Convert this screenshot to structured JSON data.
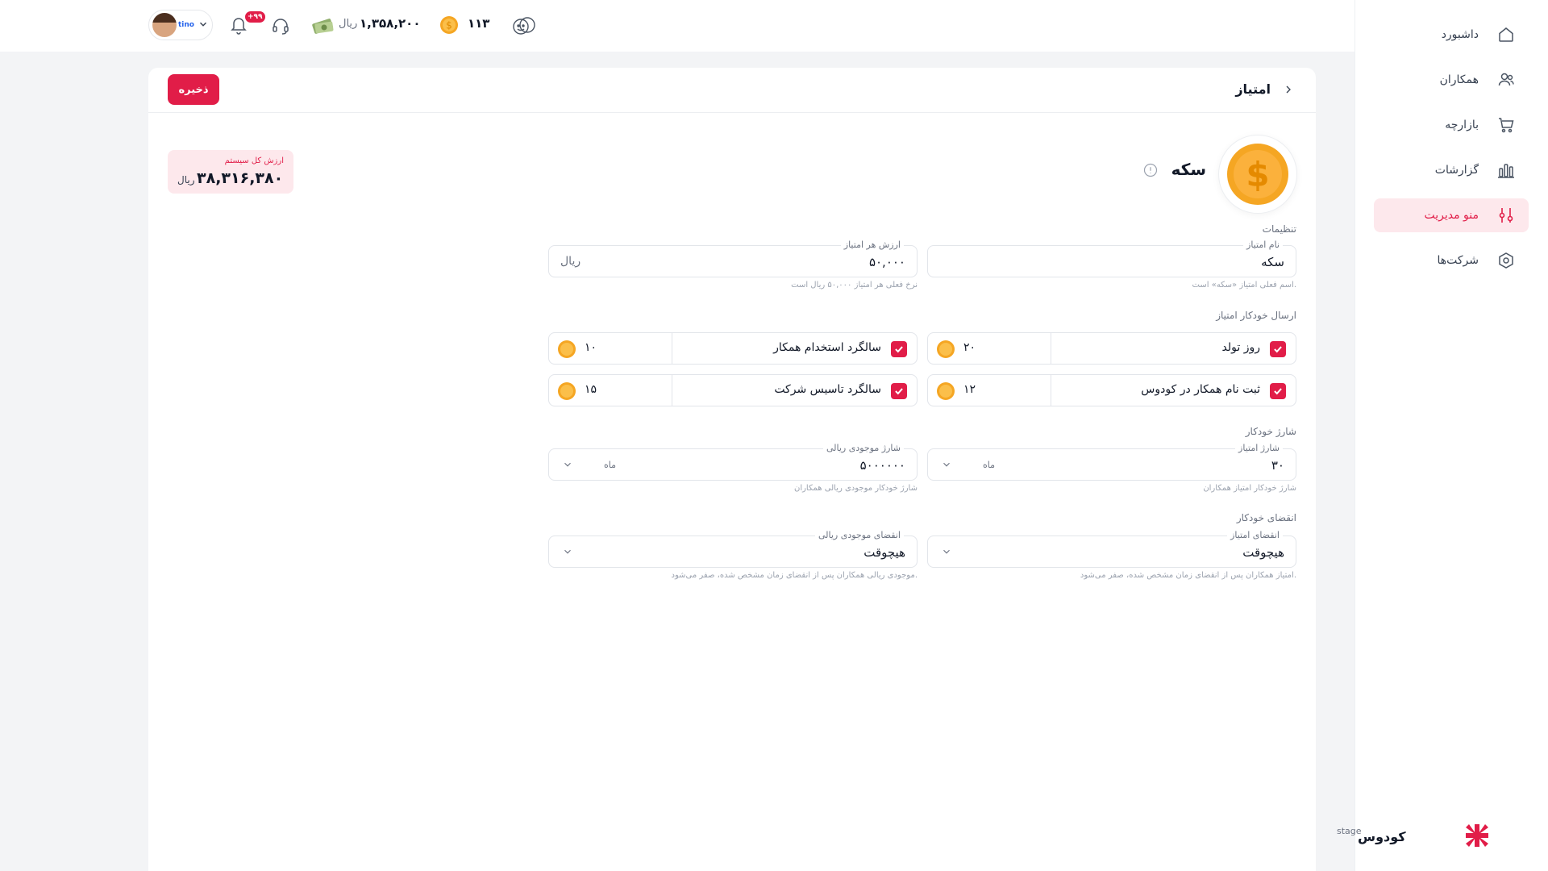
{
  "sidebar": {
    "items": [
      {
        "label": "داشبورد",
        "icon": "home-icon"
      },
      {
        "label": "همکاران",
        "icon": "users-icon"
      },
      {
        "label": "بازارچه",
        "icon": "cart-icon"
      },
      {
        "label": "گزارشات",
        "icon": "chart-bars-icon"
      },
      {
        "label": "منو مدیریت",
        "icon": "sliders-icon",
        "active": true
      },
      {
        "label": "شرکت‌ها",
        "icon": "company-icon"
      }
    ],
    "logo": {
      "stage": "stage",
      "brand": "کودوس"
    }
  },
  "topbar": {
    "profile_tag": "tino",
    "notification_badge": "+۹۹",
    "money_value": "۱,۳۵۸,۲۰۰",
    "money_unit": "ریال",
    "coin_count": "۱۱۳"
  },
  "page": {
    "title": "امتیاز",
    "save_label": "ذخیره",
    "system_value": {
      "label": "ارزش کل سیستم",
      "value": "۳۸,۳۱۶,۳۸۰",
      "unit": "ریال"
    },
    "coin_title": "سکه"
  },
  "settings": {
    "section_label": "تنظیمات",
    "name_field": {
      "label": "نام امتیاز",
      "value": "سکه",
      "hint": "اسم فعلی امتیاز «سکه» است."
    },
    "value_field": {
      "label": "ارزش هر امتیاز",
      "value": "۵۰,۰۰۰",
      "suffix": "ریال",
      "hint": "نرخ فعلی هر امتیاز ۵۰,۰۰۰ ریال است"
    }
  },
  "auto_send": {
    "section_label": "ارسال خودکار امتیاز",
    "items": [
      {
        "label": "روز تولد",
        "value": "۲۰",
        "checked": true
      },
      {
        "label": "سالگرد استخدام همکار",
        "value": "۱۰",
        "checked": true
      },
      {
        "label": "ثبت نام همکار در کودوس",
        "value": "۱۲",
        "checked": true
      },
      {
        "label": "سالگرد تاسیس شرکت",
        "value": "۱۵",
        "checked": true
      }
    ]
  },
  "auto_charge": {
    "section_label": "شارژ خودکار",
    "point_charge": {
      "label": "شارژ امتیاز",
      "value": "۳۰",
      "period": "ماه",
      "hint": "شارژ خودکار امتیاز همکاران"
    },
    "rial_charge": {
      "label": "شارژ موجودی ریالی",
      "value": "۵۰۰۰۰۰۰",
      "period": "ماه",
      "hint": "شارژ خودکار موجودی ریالی همکاران"
    }
  },
  "auto_expire": {
    "section_label": "انقضای خودکار",
    "point_expire": {
      "label": "انقضای امتیاز",
      "value": "هیچوقت",
      "hint": "امتیاز همکاران پس از انقضای زمان مشخص شده، صفر می‌شود."
    },
    "rial_expire": {
      "label": "انقضای موجودی ریالی",
      "value": "هیچوقت",
      "hint": "موجودی ریالی همکاران پس از انقضای زمان مشخص شده، صفر می‌شود."
    }
  },
  "colors": {
    "accent": "#e11d48",
    "accent_soft": "#fde8ec",
    "coin": "#f5a623"
  }
}
